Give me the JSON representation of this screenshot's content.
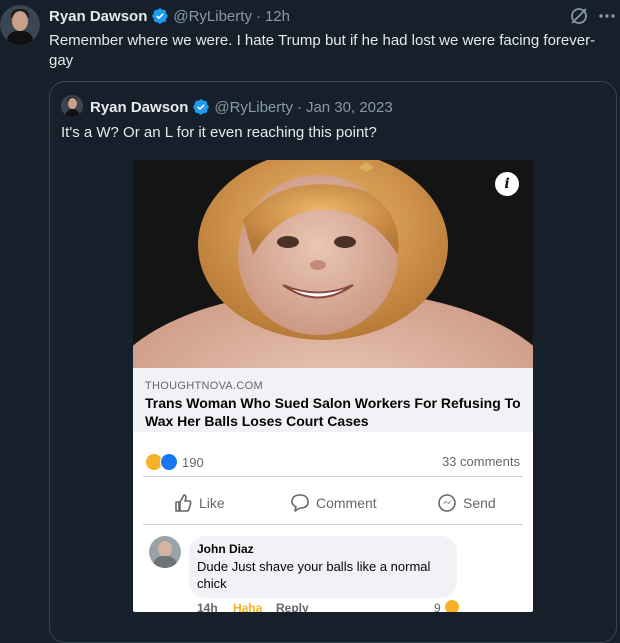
{
  "tweet": {
    "author_name": "Ryan Dawson",
    "handle": "@RyLiberty",
    "separator": "·",
    "time": "12h",
    "text": "Remember where we were. I hate Trump but if he had lost we were facing forever-gay"
  },
  "quote": {
    "author_name": "Ryan Dawson",
    "handle": "@RyLiberty",
    "separator": "·",
    "date": "Jan 30, 2023",
    "text": "It's a W? Or an L for it even reaching this point?"
  },
  "fb_post": {
    "domain": "THOUGHTNOVA.COM",
    "headline": "Trans Woman Who Sued Salon Workers For Refusing To Wax Her Balls Loses Court Cases",
    "reaction_count": "190",
    "comment_count": "33 comments",
    "buttons": {
      "like": "Like",
      "comment": "Comment",
      "send": "Send"
    },
    "comment": {
      "author": "John Diaz",
      "text": "Dude  Just shave your balls like a normal chick",
      "time": "14h",
      "reaction": "Haha",
      "reply": "Reply",
      "reactions_count": "9"
    }
  },
  "colors": {
    "background": "#15202b",
    "verified": "#1d9bf0",
    "muted": "#8b98a5",
    "border": "#38444d"
  }
}
